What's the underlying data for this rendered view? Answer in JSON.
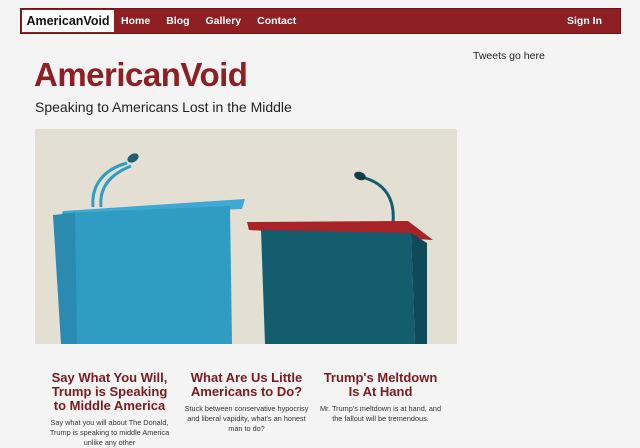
{
  "navbar": {
    "brand": "AmericanVoid",
    "links": [
      "Home",
      "Blog",
      "Gallery",
      "Contact"
    ],
    "signin": "Sign In"
  },
  "sidebar": {
    "tweets": "Tweets go here"
  },
  "header": {
    "title": "AmericanVoid",
    "tagline": "Speaking to Americans Lost in the Middle"
  },
  "articles": [
    {
      "title": "Say What You Will, Trump is Speaking to Middle America",
      "excerpt": "Say what you will about The Donald, Trump is speaking to middle America unlike any other"
    },
    {
      "title": "What Are Us Little Americans to Do?",
      "excerpt": "Stuck between conservative hypocrisy and liberal vapidity, what's an honest man to do?"
    },
    {
      "title": "Trump's Meltdown Is At Hand",
      "excerpt": "Mr. Trump's meltdown is at hand, and the fallout will be tremendous."
    }
  ],
  "colors": {
    "brand_red": "#8e1f23",
    "podium_blue": "#2f9cc4",
    "podium_teal": "#135d6e",
    "background": "#e3dfd3"
  }
}
